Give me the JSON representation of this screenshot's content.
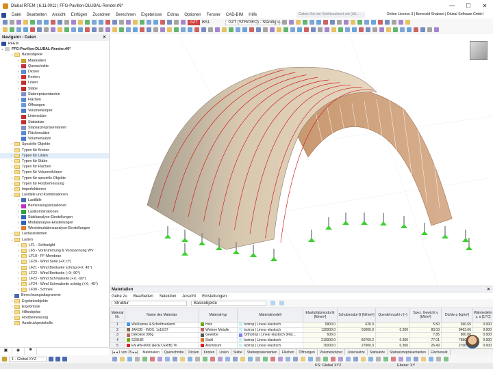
{
  "window": {
    "title": "Dlubal RFEM | 6.11.0011 | FFG-Pavillon-DLUBAL-Render.rf6*",
    "controls": [
      "—",
      "☐",
      "✕"
    ]
  },
  "menu": {
    "items": [
      "Datei",
      "Bearbeiten",
      "Ansicht",
      "Einfügen",
      "Zuordnen",
      "Berechnen",
      "Ergebnisse",
      "Extras",
      "Optionen",
      "Fenster",
      "CAD-BIM",
      "Hilfe"
    ],
    "search_placeholder": "Geben Sie ein Schlüsselwort ein (Alt...",
    "license": "Online License 3 | Benerald Shabani | Dlubal Software GmbH"
  },
  "toolbar": {
    "lc_badge": "GZT",
    "lc_name": "BS1",
    "combo": "GZT (STR/GEO) - Ständig u..."
  },
  "navigator": {
    "title": "Navigator - Daten",
    "root": "RFEM",
    "file": "FFG-Pavillon-DLUBAL-Render.rf6*",
    "items": [
      {
        "label": "Basisobjekte",
        "lvl": 1,
        "open": true,
        "icon": "folder"
      },
      {
        "label": "Materialien",
        "lvl": 2,
        "arrow": true,
        "icon": "#c8a030"
      },
      {
        "label": "Querschnitte",
        "lvl": 2,
        "arrow": true,
        "icon": "#c03040"
      },
      {
        "label": "Dicken",
        "lvl": 2,
        "arrow": true,
        "icon": "#5a8ad0"
      },
      {
        "label": "Knoten",
        "lvl": 2,
        "arrow": true,
        "icon": "#d03030"
      },
      {
        "label": "Linien",
        "lvl": 2,
        "arrow": true,
        "icon": "#c03030"
      },
      {
        "label": "Stäbe",
        "lvl": 2,
        "arrow": true,
        "icon": "#c03030"
      },
      {
        "label": "Stabrepräsentanten",
        "lvl": 2,
        "icon": "#8090c0"
      },
      {
        "label": "Flächen",
        "lvl": 2,
        "arrow": true,
        "icon": "#5a8ad0"
      },
      {
        "label": "Öffnungen",
        "lvl": 2,
        "icon": "#6a9ad8"
      },
      {
        "label": "Volumenkörper",
        "lvl": 2,
        "icon": "#4a7ac8"
      },
      {
        "label": "Liniensätze",
        "lvl": 2,
        "icon": "#c03030"
      },
      {
        "label": "Stabsätze",
        "lvl": 2,
        "icon": "#c03030"
      },
      {
        "label": "Stabsatzrepräsentanten",
        "lvl": 2,
        "icon": "#8090c0"
      },
      {
        "label": "Flächensätze",
        "lvl": 2,
        "icon": "#5a8ad0"
      },
      {
        "label": "Volumensätze",
        "lvl": 2,
        "icon": "#4a7ac8"
      },
      {
        "label": "Spezielle Objekte",
        "lvl": 1,
        "arrow": true,
        "icon": "folder"
      },
      {
        "label": "Typen für Knoten",
        "lvl": 1,
        "arrow": true,
        "icon": "folder"
      },
      {
        "label": "Typen für Linien",
        "lvl": 1,
        "arrow": true,
        "icon": "folder",
        "sel": true
      },
      {
        "label": "Typen für Stäbe",
        "lvl": 1,
        "arrow": true,
        "icon": "folder"
      },
      {
        "label": "Typen für Flächen",
        "lvl": 1,
        "arrow": true,
        "icon": "folder"
      },
      {
        "label": "Typen für Volumenkörper",
        "lvl": 1,
        "arrow": true,
        "icon": "folder"
      },
      {
        "label": "Typen für spezielle Objekte",
        "lvl": 1,
        "arrow": true,
        "icon": "folder"
      },
      {
        "label": "Typen für Holzbemessung",
        "lvl": 1,
        "arrow": true,
        "icon": "folder"
      },
      {
        "label": "Imperfektionen",
        "lvl": 1,
        "arrow": true,
        "icon": "folder"
      },
      {
        "label": "Lastfälle und Kombinationen",
        "lvl": 1,
        "open": true,
        "icon": "folder"
      },
      {
        "label": "Lastfälle",
        "lvl": 2,
        "arrow": true,
        "icon": "#4a6ab0"
      },
      {
        "label": "Bemessungssituationen",
        "lvl": 2,
        "arrow": true,
        "icon": "#c030c0"
      },
      {
        "label": "Lastkombinationen",
        "lvl": 2,
        "arrow": true,
        "icon": "#30a040"
      },
      {
        "label": "Statikanalyse-Einstellungen",
        "lvl": 2,
        "arrow": true,
        "icon": "#3060c0"
      },
      {
        "label": "Modalanalyse-Einstellungen",
        "lvl": 2,
        "arrow": true,
        "icon": "#3060c0"
      },
      {
        "label": "Windsimulationsanalyse-Einstellungen",
        "lvl": 2,
        "arrow": true,
        "icon": "#e08030"
      },
      {
        "label": "Lastassistenten",
        "lvl": 1,
        "arrow": true,
        "icon": "folder"
      },
      {
        "label": "Lasten",
        "lvl": 1,
        "open": true,
        "icon": "folder"
      },
      {
        "label": "LF1 - Selfweight",
        "lvl": 2,
        "arrow": true,
        "icon": "folder"
      },
      {
        "label": "LF5 - Vorkrümmung & Vorspannung WV",
        "lvl": 2,
        "arrow": true,
        "icon": "folder"
      },
      {
        "label": "LF10 - FF-Membran",
        "lvl": 2,
        "arrow": true,
        "icon": "folder"
      },
      {
        "label": "LF20 - Wind Seite (+X; 0°)",
        "lvl": 2,
        "arrow": true,
        "icon": "folder"
      },
      {
        "label": "LF21 - Wind Breitseite schräg (+X; 45°)",
        "lvl": 2,
        "arrow": true,
        "icon": "folder"
      },
      {
        "label": "LF22 - Wind Breitseite (+X; 90°)",
        "lvl": 2,
        "arrow": true,
        "icon": "folder"
      },
      {
        "label": "LF23 - Wind Schmalseite (+X; -90°)",
        "lvl": 2,
        "arrow": true,
        "icon": "folder"
      },
      {
        "label": "LF24 - Wind Schmalseite schräg (+X; -45°)",
        "lvl": 2,
        "arrow": true,
        "icon": "folder"
      },
      {
        "label": "LF30 - Schnee",
        "lvl": 2,
        "arrow": true,
        "icon": "folder"
      },
      {
        "label": "Berechnungsdiagramme",
        "lvl": 1,
        "arrow": true,
        "icon": "#4a6ab0"
      },
      {
        "label": "Ergebnisobjekte",
        "lvl": 1,
        "arrow": true,
        "icon": "folder"
      },
      {
        "label": "Ergebnisse",
        "lvl": 1,
        "arrow": true,
        "icon": "folder"
      },
      {
        "label": "Hilfsobjekte",
        "lvl": 1,
        "arrow": true,
        "icon": "folder"
      },
      {
        "label": "Holzbemessung",
        "lvl": 1,
        "arrow": true,
        "icon": "folder"
      },
      {
        "label": "Ausdruckprotokolle",
        "lvl": 1,
        "icon": "folder"
      }
    ],
    "coord_system": "1 - Global XYZ"
  },
  "table": {
    "title": "Materialien",
    "menu": [
      "Gehe zu",
      "Bearbeiten",
      "Selektion",
      "Ansicht",
      "Einstellungen"
    ],
    "dropdown1": "Struktur",
    "dropdown2": "Basisobjekte",
    "headers": [
      "Material Nr.",
      "Name des Materials",
      "Material-typ",
      "Materialmodell",
      "Elastizitätsmodul E [N/mm²]",
      "Schubmodul G [N/mm²]",
      "Querdehnzahl ν [–]",
      "Spez. Gewicht γ [kN/m³]",
      "Dichte ρ [kg/m³]",
      "Wärmedehnz. α [1/°C]"
    ],
    "rows": [
      {
        "nr": "1",
        "name": "Weißtanne 4-Schichtverleimt",
        "ncol": "#3a9ae8",
        "typ": "Holz",
        "tcol": "#6aaa10",
        "model": "Isotrop | Linear elastisch",
        "mcol": "#c8f4f8",
        "E": "9900.0",
        "G": "620.0",
        "nu": "",
        "g": "5.50",
        "rho": "560.65",
        "a": "0.000"
      },
      {
        "nr": "2",
        "name": "JAKOB - INOX, 1x19/37",
        "ncol": "#8a7050",
        "typ": "Weitere Metalle",
        "tcol": "#c06060",
        "model": "Isotrop | Linear elastisch",
        "mcol": "#c8f4f8",
        "E": "130000.0",
        "G": "50000.0",
        "nu": "0.300",
        "g": "83.03",
        "rho": "8463.66",
        "a": "0.000"
      },
      {
        "nr": "3",
        "name": "Dekotext 300g",
        "ncol": "#c06060",
        "typ": "Gewebe",
        "tcol": "#555555",
        "model": "Orthotrop | Linear elastisch (Fläc...",
        "mcol": "#8080f0",
        "E": "600.0",
        "G": "",
        "nu": "",
        "g": "7.85",
        "rho": "800.00",
        "a": "0.000"
      },
      {
        "nr": "4",
        "name": "S235JR",
        "ncol": "#6aaa10",
        "typ": "Stahl",
        "tcol": "#e07020",
        "model": "Isotrop | Linear elastisch",
        "mcol": "#c8f4f8",
        "E": "210000.0",
        "G": "80769.2",
        "nu": "0.300",
        "g": "77.01",
        "rho": "7850.00",
        "a": "0.000"
      },
      {
        "nr": "5",
        "name": "EN AW-6060 (EP,ET,ER/B) T6",
        "ncol": "#e02020",
        "typ": "Aluminium",
        "tcol": "#e02020",
        "model": "Isotrop | Linear elastisch",
        "mcol": "#c8f4f8",
        "E": "70000.0",
        "G": "27000.0",
        "nu": "0.300",
        "g": "26.49",
        "rho": "2700.00",
        "a": "0.000"
      }
    ],
    "pager": "1 von 15",
    "tabs": [
      "Materialien",
      "Querschnitte",
      "Dicken",
      "Knoten",
      "Linien",
      "Stäbe",
      "Stabrepräsentanten",
      "Flächen",
      "Öffnungen",
      "Volumenkörper",
      "Liniensätze",
      "Stabsätze",
      "Stabsatzrepräsentanten",
      "Flächensät"
    ]
  },
  "status": {
    "cs": "KS: Global XYZ",
    "plane": "Ebene: XY"
  }
}
